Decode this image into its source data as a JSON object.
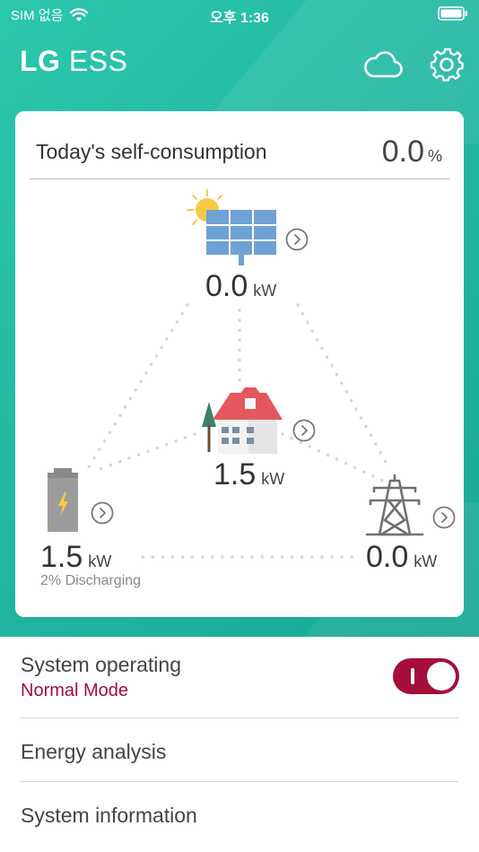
{
  "status_bar": {
    "carrier": "SIM 없음",
    "time": "오후 1:36"
  },
  "header": {
    "brand": "LG",
    "product": "ESS"
  },
  "summary": {
    "title": "Today's self-consumption",
    "value": "0.0",
    "unit": "%"
  },
  "flow": {
    "solar": {
      "value": "0.0",
      "unit": "kW"
    },
    "home": {
      "value": "1.5",
      "unit": "kW"
    },
    "battery": {
      "value": "1.5",
      "unit": "kW",
      "status": "2% Discharging"
    },
    "grid": {
      "value": "0.0",
      "unit": "kW"
    }
  },
  "menu": {
    "system_operating": "System operating",
    "mode": "Normal Mode",
    "energy_analysis": "Energy analysis",
    "system_information": "System information"
  },
  "colors": {
    "teal": "#22b8a3",
    "accent": "#a50d3b"
  }
}
